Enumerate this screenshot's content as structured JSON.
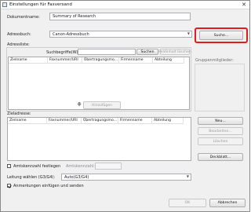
{
  "window": {
    "title": "Einstellungen für Faxversand",
    "close": "✕"
  },
  "document_name": {
    "label": "Dokumentname:",
    "value": "Summary of Research"
  },
  "address_book": {
    "label": "Adressbuch:",
    "value": "Canon-Adressbuch",
    "search_button": "Suche..."
  },
  "address_list": {
    "label": "Adressliste:",
    "search_term_label": "Suchbegriffe(W):",
    "search_value": "",
    "search_button": "Suchen",
    "clear_button": "Feldinhalt löschen",
    "columns": [
      "Zielname",
      "Faxnummer/URI",
      "Übertragungsmo...",
      "Firmenname",
      "Abteilung"
    ]
  },
  "group_members": {
    "label": "Gruppenmitglieder:"
  },
  "add_button": "Hinzufügen",
  "destination": {
    "label": "Zieladresse:",
    "columns": [
      "Zielname",
      "Faxnummer/URI",
      "Übertragungsmo...",
      "Firmenname",
      "Abteilung"
    ],
    "new_button": "Neu...",
    "edit_button": "Bearbeiten...",
    "delete_button": "Löschen"
  },
  "cover_button": "Deckblatt...",
  "outside_line": {
    "checkbox_label": "Amtskennzahl festlegen",
    "checked": false,
    "number_label": "Amtskennzahl:",
    "number_value": ""
  },
  "line": {
    "label": "Leitung wählen (G3/G4):",
    "value": "Auto(G3/G4)"
  },
  "log": {
    "label": "Anmerkungen einfügen und senden",
    "checked": true
  },
  "footer": {
    "ok": "OK",
    "cancel": "Abbrechen"
  }
}
